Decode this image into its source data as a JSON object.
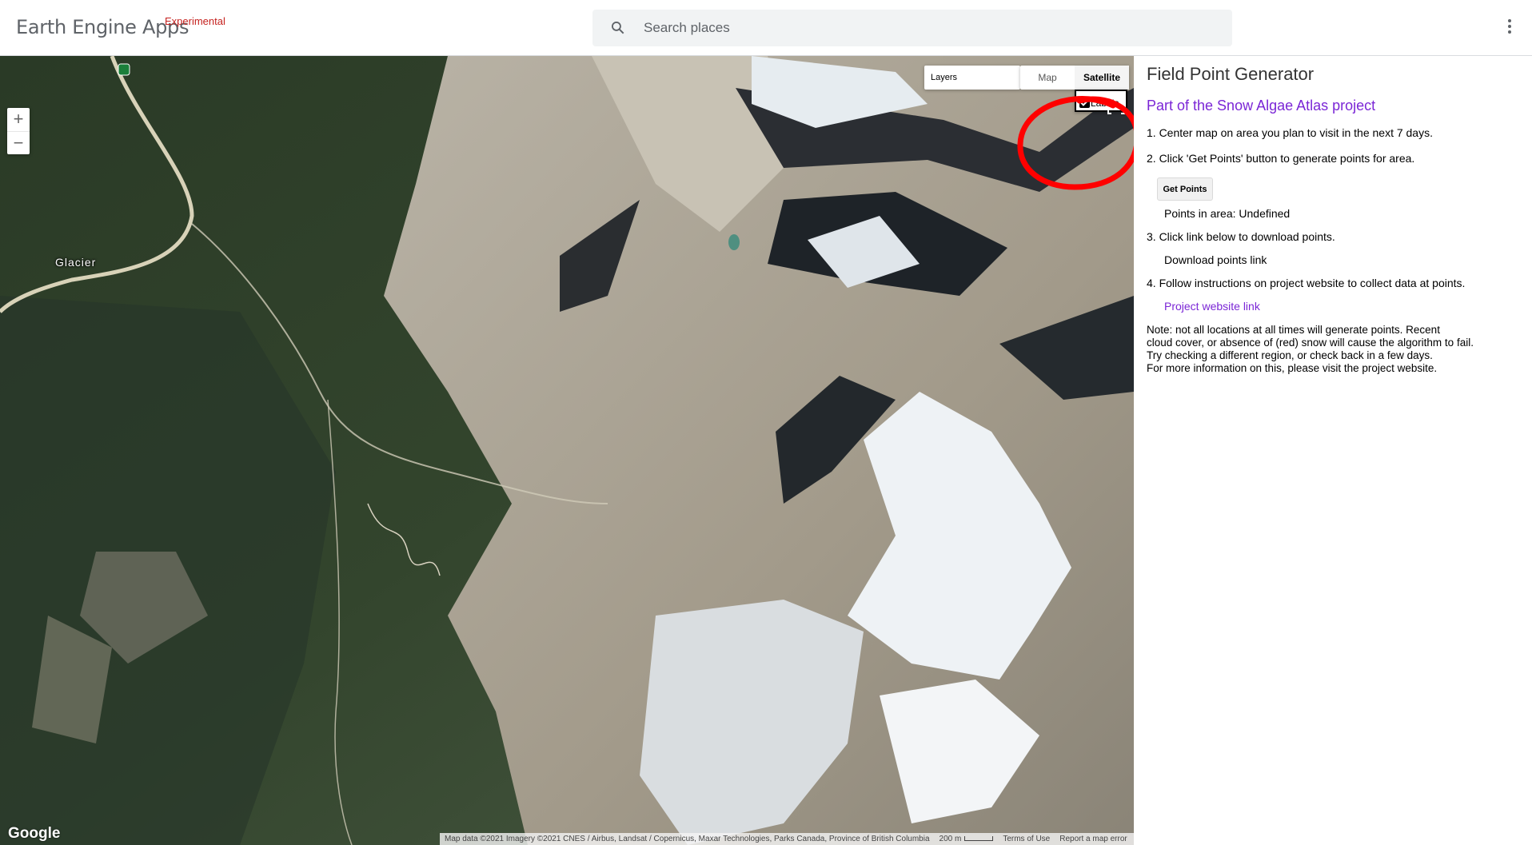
{
  "header": {
    "app_name": "Earth Engine Apps",
    "app_tag": "Experimental",
    "search_placeholder": "Search places",
    "menu_icon": "more-vert-icon",
    "search_icon": "search-icon"
  },
  "map": {
    "place_label": "Glacier",
    "zoom_in": "+",
    "zoom_out": "−",
    "layers_label": "Layers",
    "map_type": {
      "options": [
        "Map",
        "Satellite"
      ],
      "selected": "Satellite"
    },
    "labels_checkbox": {
      "label": "Labels",
      "checked": true
    },
    "google_logo": "Google",
    "attribution": "Map data ©2021 Imagery ©2021 CNES / Airbus, Landsat / Copernicus, Maxar Technologies, Parks Canada, Province of British Columbia",
    "scale": "200 m",
    "terms": "Terms of Use",
    "report": "Report a map error",
    "annotation_color": "#ff0000"
  },
  "panel": {
    "title": "Field Point Generator",
    "project_link": "Part of the Snow Algae Atlas project",
    "step1": "1. Center map on area you plan to visit in the next 7 days.",
    "step2": "2. Click 'Get Points' button to generate points for area.",
    "get_points_button": "Get Points",
    "points_in_area": "Points in area: Undefined",
    "step3": "3. Click link below to download points.",
    "download_link": "Download points link",
    "step4": "4. Follow instructions on project website to collect data at points.",
    "website_link": "Project website link",
    "note_lines": [
      "Note: not all locations at all times will generate points. Recent",
      "cloud cover, or absence of (red) snow will cause the algorithm to fail.",
      "Try checking a different region, or check back in a few days.",
      "For more information on this, please visit the project website."
    ],
    "link_color": "#7b26d6"
  }
}
